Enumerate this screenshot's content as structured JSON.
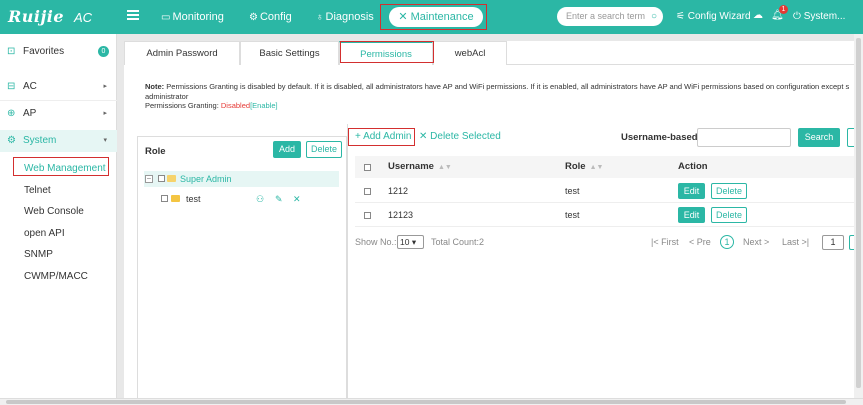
{
  "app": {
    "logo": "Ruijie",
    "product": "AC"
  },
  "topnav": {
    "monitoring": "Monitoring",
    "config": "Config",
    "diagnosis": "Diagnosis",
    "maintenance": "Maintenance",
    "search_placeholder": "Enter a search term",
    "config_wizard": "Config Wizard",
    "notification_count": "1",
    "system_menu": "System..."
  },
  "sidebar": {
    "favorites": "Favorites",
    "favorites_count": "0",
    "ac": "AC",
    "ap": "AP",
    "system": "System",
    "system_items": [
      "Web Management",
      "Telnet",
      "Web Console",
      "open API",
      "SNMP",
      "CWMP/MACC"
    ]
  },
  "tabs": [
    "Admin Password",
    "Basic Settings",
    "Permissions",
    "webAcl"
  ],
  "active_tab": "Permissions",
  "note": {
    "label": "Note:",
    "text": "Permissions Granting is disabled by default. If it is disabled, all administrators have AP and WiFi permissions. If it is enabled, all administrators have AP and WiFi permissions based on configuration except s",
    "text2": "administrator",
    "granting_label": "Permissions Granting:",
    "granting_status": "Disabled",
    "enable_link": "[Enable]"
  },
  "role_panel": {
    "title": "Role",
    "add": "Add",
    "delete": "Delete",
    "tree": [
      {
        "label": "Super Admin",
        "selected": true
      },
      {
        "label": "test",
        "selected": false
      }
    ]
  },
  "admin_panel": {
    "add_admin": "+ Add Admin",
    "delete_selected": "Delete Selected",
    "filter_label": "Username-based:",
    "filter_value": "",
    "search": "Search",
    "columns": [
      "Username",
      "Role",
      "Action"
    ],
    "rows": [
      {
        "username": "1212",
        "role": "test",
        "edit": "Edit",
        "delete": "Delete"
      },
      {
        "username": "12123",
        "role": "test",
        "edit": "Edit",
        "delete": "Delete"
      }
    ]
  },
  "pager": {
    "show_no_label": "Show No.:",
    "page_size": "10",
    "total_count": "Total Count:2",
    "first": "First",
    "prev": "Pre",
    "current": "1",
    "next": "Next",
    "last": "Last",
    "goto_value": "1"
  },
  "colors": {
    "brand": "#2bb7a5",
    "highlight": "#d32f2f",
    "danger": "#e53935"
  }
}
